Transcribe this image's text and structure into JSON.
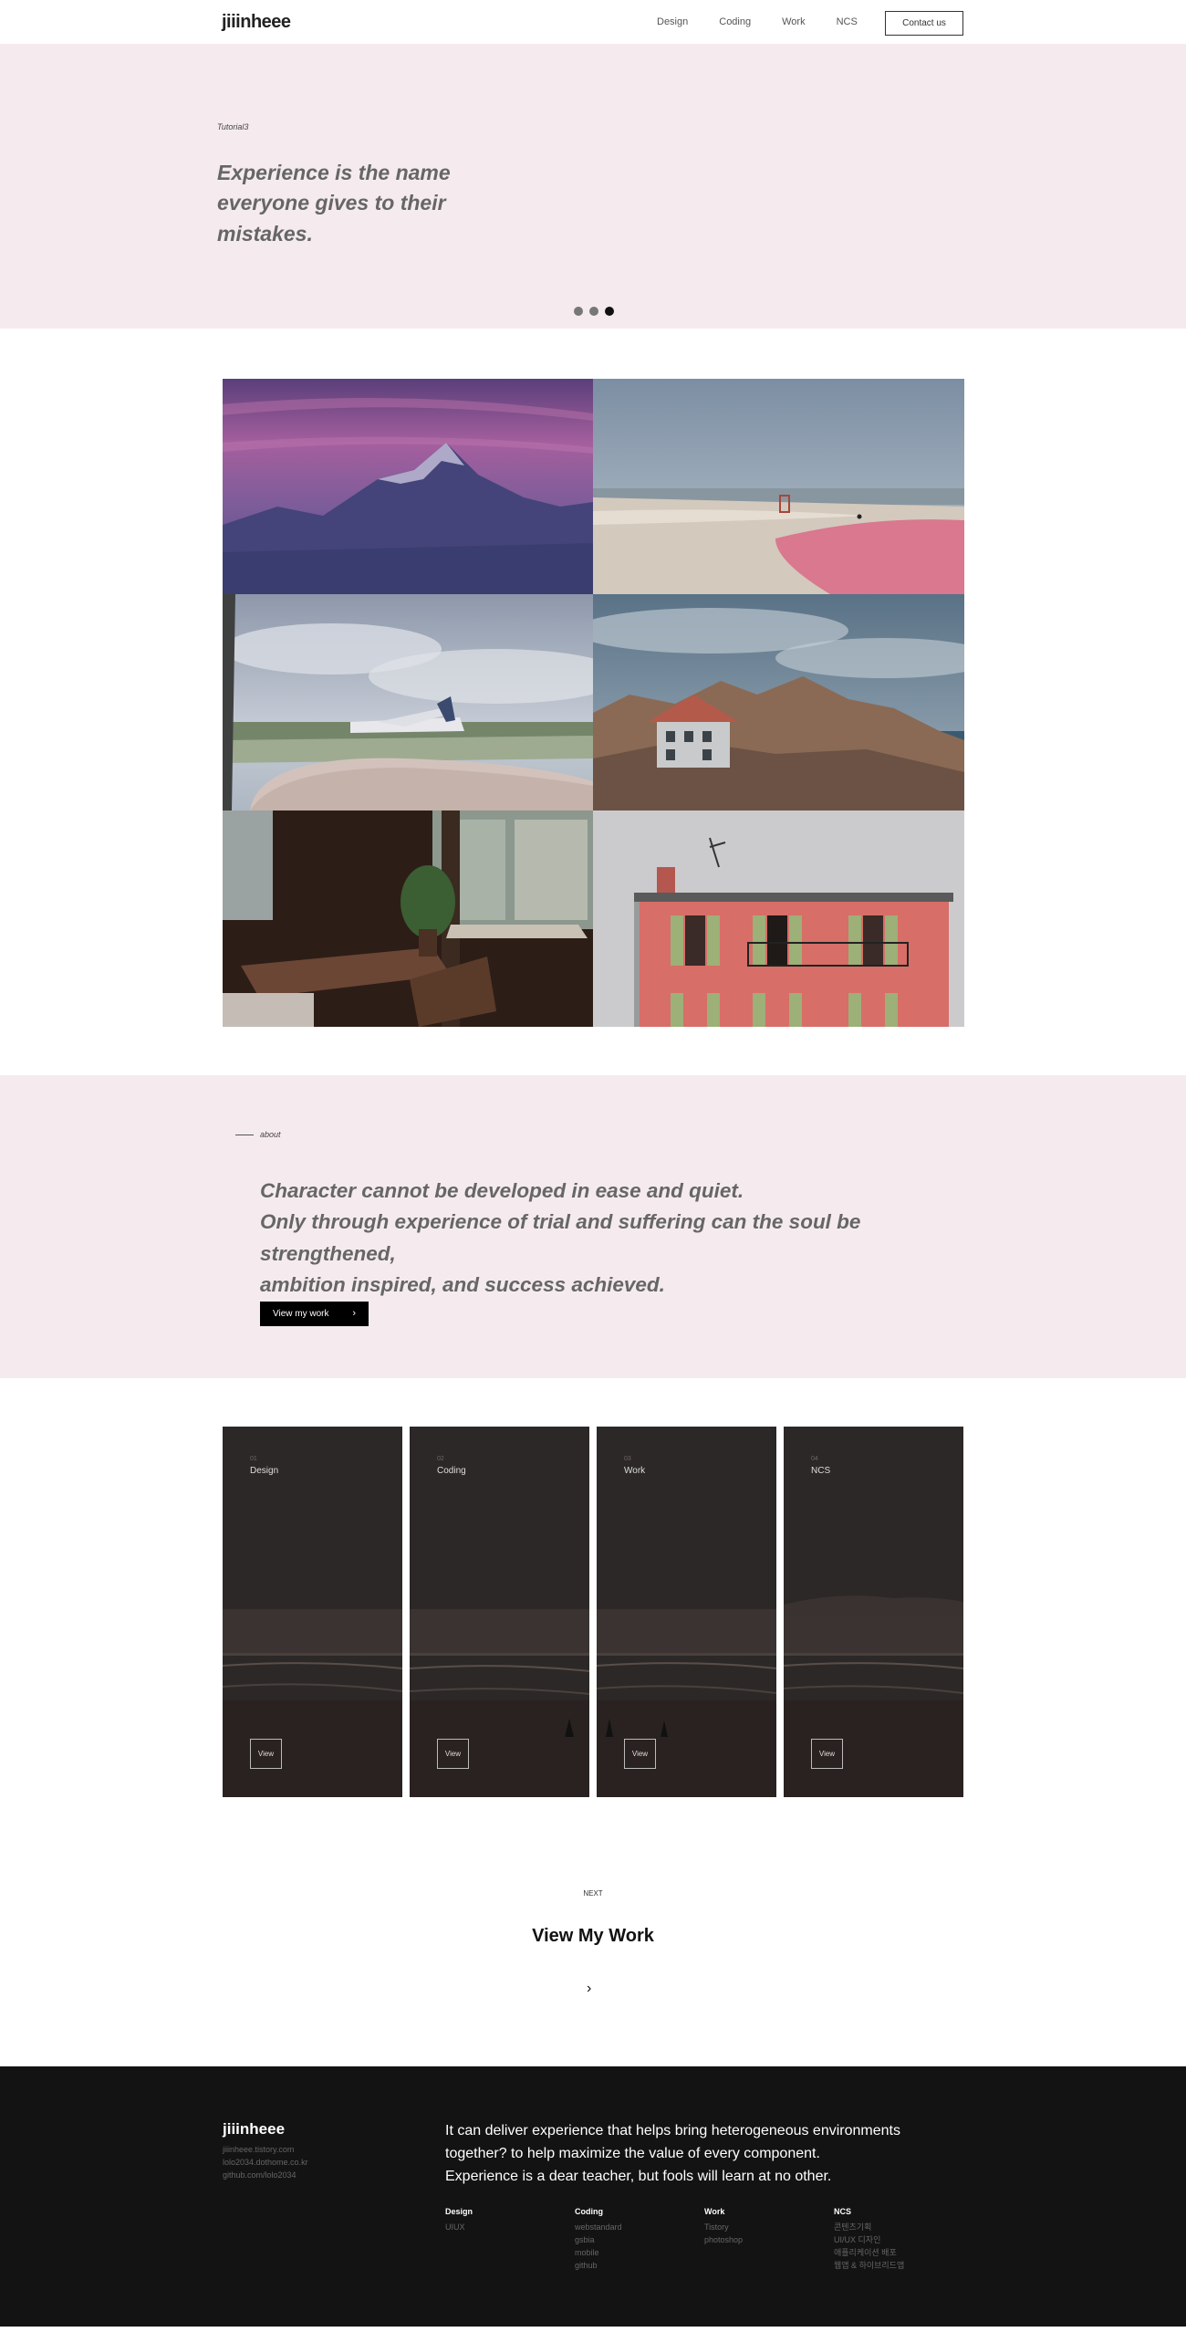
{
  "header": {
    "logo": "jiiinheee",
    "nav": [
      "Design",
      "Coding",
      "Work",
      "NCS"
    ],
    "contact_label": "Contact us"
  },
  "hero": {
    "tag": "Tutorial3",
    "quote": "Experience is the name everyone gives to their mistakes.",
    "slides": 3,
    "active_slide": 3
  },
  "gallery": {
    "photos": [
      "mountain",
      "beach",
      "airplane",
      "coastal-house",
      "cafe-interior",
      "pink-building"
    ]
  },
  "about": {
    "label": "about",
    "quote_lines": [
      "Character cannot be developed in ease and quiet.",
      "Only through experience of trial and suffering can the soul be strengthened,",
      "ambition inspired, and success achieved."
    ],
    "button_label": "View my work",
    "button_icon": "chevron-right-icon"
  },
  "cards": [
    {
      "num": "01",
      "title": "Design",
      "view": "View"
    },
    {
      "num": "02",
      "title": "Coding",
      "view": "View"
    },
    {
      "num": "03",
      "title": "Work",
      "view": "View"
    },
    {
      "num": "04",
      "title": "NCS",
      "view": "View"
    }
  ],
  "next": {
    "label": "NEXT",
    "title": "View My Work",
    "arrow_icon": "chevron-right-icon"
  },
  "footer": {
    "logo": "jiiinheee",
    "links": [
      "jiiinheee.tistory.com",
      "lolo2034.dothome.co.kr",
      "github.com/lolo2034"
    ],
    "text_lines": [
      "It can deliver experience that helps bring heterogeneous environments",
      "together? to help maximize the value of every component.",
      "Experience is a dear teacher, but fools will learn at no other."
    ],
    "columns": [
      {
        "title": "Design",
        "items": [
          "UIUX"
        ]
      },
      {
        "title": "Coding",
        "items": [
          "webstandard",
          "gsbia",
          "mobile",
          "github"
        ]
      },
      {
        "title": "Work",
        "items": [
          "Tistory",
          "photoshop"
        ]
      },
      {
        "title": "NCS",
        "items": [
          "콘텐츠기획",
          "UI/UX 디자인",
          "애플리케이션 배포",
          "웹앱 & 하이브리드앱"
        ]
      }
    ]
  },
  "colors": {
    "pink_bg": "#f5ebee",
    "footer_bg": "#131313",
    "quote_text": "#666666"
  }
}
